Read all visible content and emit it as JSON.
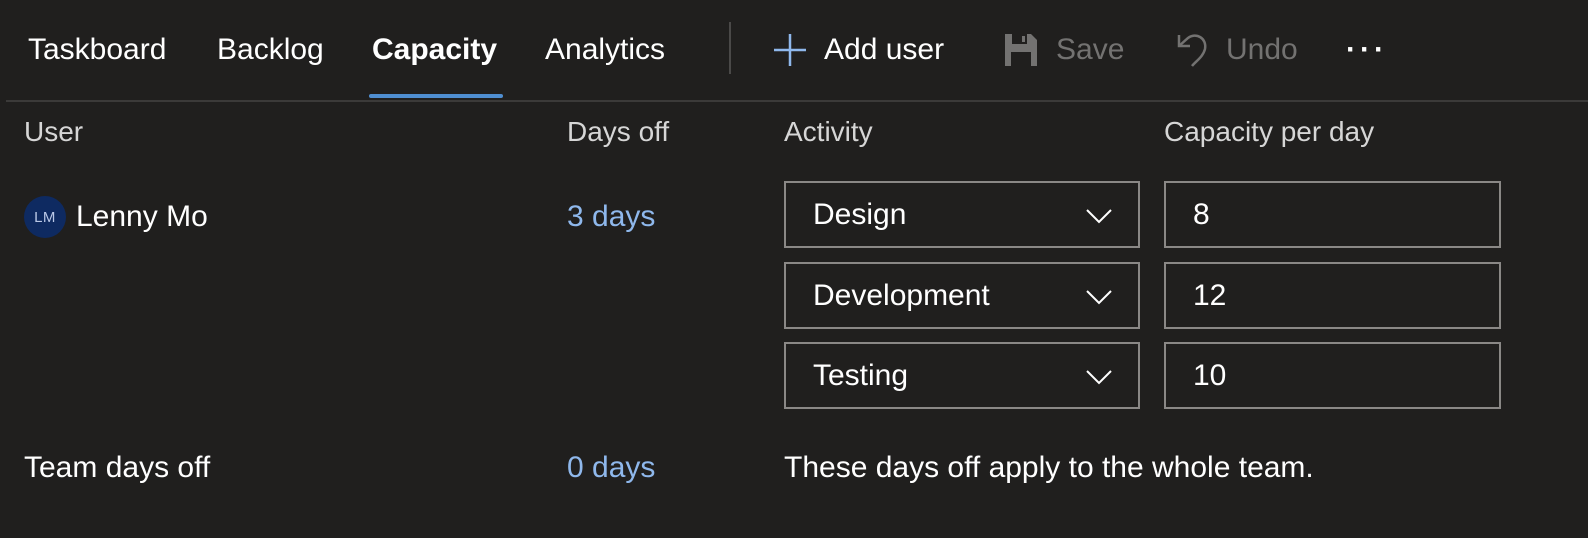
{
  "tabs": [
    {
      "label": "Taskboard",
      "selected": false
    },
    {
      "label": "Backlog",
      "selected": false
    },
    {
      "label": "Capacity",
      "selected": true
    },
    {
      "label": "Analytics",
      "selected": false
    }
  ],
  "commands": {
    "add_user": {
      "label": "Add user",
      "icon": "plus-icon",
      "enabled": true
    },
    "save": {
      "label": "Save",
      "icon": "save-icon",
      "enabled": false
    },
    "undo": {
      "label": "Undo",
      "icon": "undo-icon",
      "enabled": false
    },
    "more": {
      "icon": "more-icon",
      "glyph": "···"
    }
  },
  "columns": {
    "user": "User",
    "days_off": "Days off",
    "activity": "Activity",
    "capacity": "Capacity per day"
  },
  "user_row": {
    "initials": "LM",
    "name": "Lenny Mo",
    "days_off": "3 days",
    "activities": [
      {
        "activity": "Design",
        "capacity": "8"
      },
      {
        "activity": "Development",
        "capacity": "12"
      },
      {
        "activity": "Testing",
        "capacity": "10"
      }
    ]
  },
  "team_row": {
    "label": "Team days off",
    "days_off": "0 days",
    "note": "These days off apply to the whole team."
  },
  "colors": {
    "background": "#201f1e",
    "accent": "#4f8ed1",
    "link": "#8fb8ec",
    "disabled": "#737271",
    "avatar": "#0e2a61"
  }
}
